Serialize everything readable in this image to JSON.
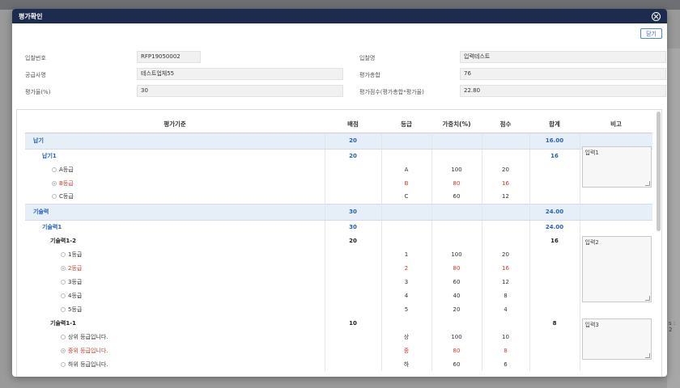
{
  "modal": {
    "title": "평가확인",
    "close_label": "닫기"
  },
  "info": {
    "rfp_no_label": "입찰번호",
    "rfp_no": "RFP19050002",
    "bid_name_label": "입찰명",
    "bid_name": "입력테스트",
    "supplier_label": "공급사명",
    "supplier": "테스트업체55",
    "total_label": "평가총합",
    "total": "76",
    "rate_label": "평가율(%)",
    "rate": "30",
    "score_label": "평가점수(평가총합*평가율)",
    "score": "22.80"
  },
  "table": {
    "headers": [
      "평가기준",
      "배점",
      "등급",
      "가중치(%)",
      "점수",
      "합계",
      "비고"
    ],
    "g1": {
      "name": "납기",
      "points": "20",
      "sum": "16.00"
    },
    "g1s1": {
      "name": "납기1",
      "points": "20",
      "sum": "16",
      "memo": "입력1"
    },
    "g1opts": [
      {
        "label": "A등급",
        "grade": "A",
        "weight": "100",
        "score": "20"
      },
      {
        "label": "B등급",
        "grade": "B",
        "weight": "80",
        "score": "16"
      },
      {
        "label": "C등급",
        "grade": "C",
        "weight": "60",
        "score": "12"
      }
    ],
    "g2": {
      "name": "기술력",
      "points": "30",
      "sum": "24.00"
    },
    "g2s1": {
      "name": "기술력1",
      "points": "30",
      "sum": "24.00"
    },
    "g2s1a": {
      "name": "기술력1-2",
      "points": "20",
      "sum": "16",
      "memo": "입력2"
    },
    "g2aopts": [
      {
        "label": "1등급",
        "grade": "1",
        "weight": "100",
        "score": "20"
      },
      {
        "label": "2등급",
        "grade": "2",
        "weight": "80",
        "score": "16"
      },
      {
        "label": "3등급",
        "grade": "3",
        "weight": "60",
        "score": "12"
      },
      {
        "label": "4등급",
        "grade": "4",
        "weight": "40",
        "score": "8"
      },
      {
        "label": "5등급",
        "grade": "5",
        "weight": "20",
        "score": "4"
      }
    ],
    "g2s1b": {
      "name": "기술력1-1",
      "points": "10",
      "sum": "8",
      "memo": "입력3"
    },
    "g2bopts": [
      {
        "label": "상위 등급입니다.",
        "grade": "상",
        "weight": "100",
        "score": "10"
      },
      {
        "label": "중위 등급입니다.",
        "grade": "중",
        "weight": "80",
        "score": "8"
      },
      {
        "label": "하위 등급입니다.",
        "grade": "하",
        "weight": "60",
        "score": "6"
      }
    ]
  },
  "background": {
    "side_text": "s : 2"
  }
}
